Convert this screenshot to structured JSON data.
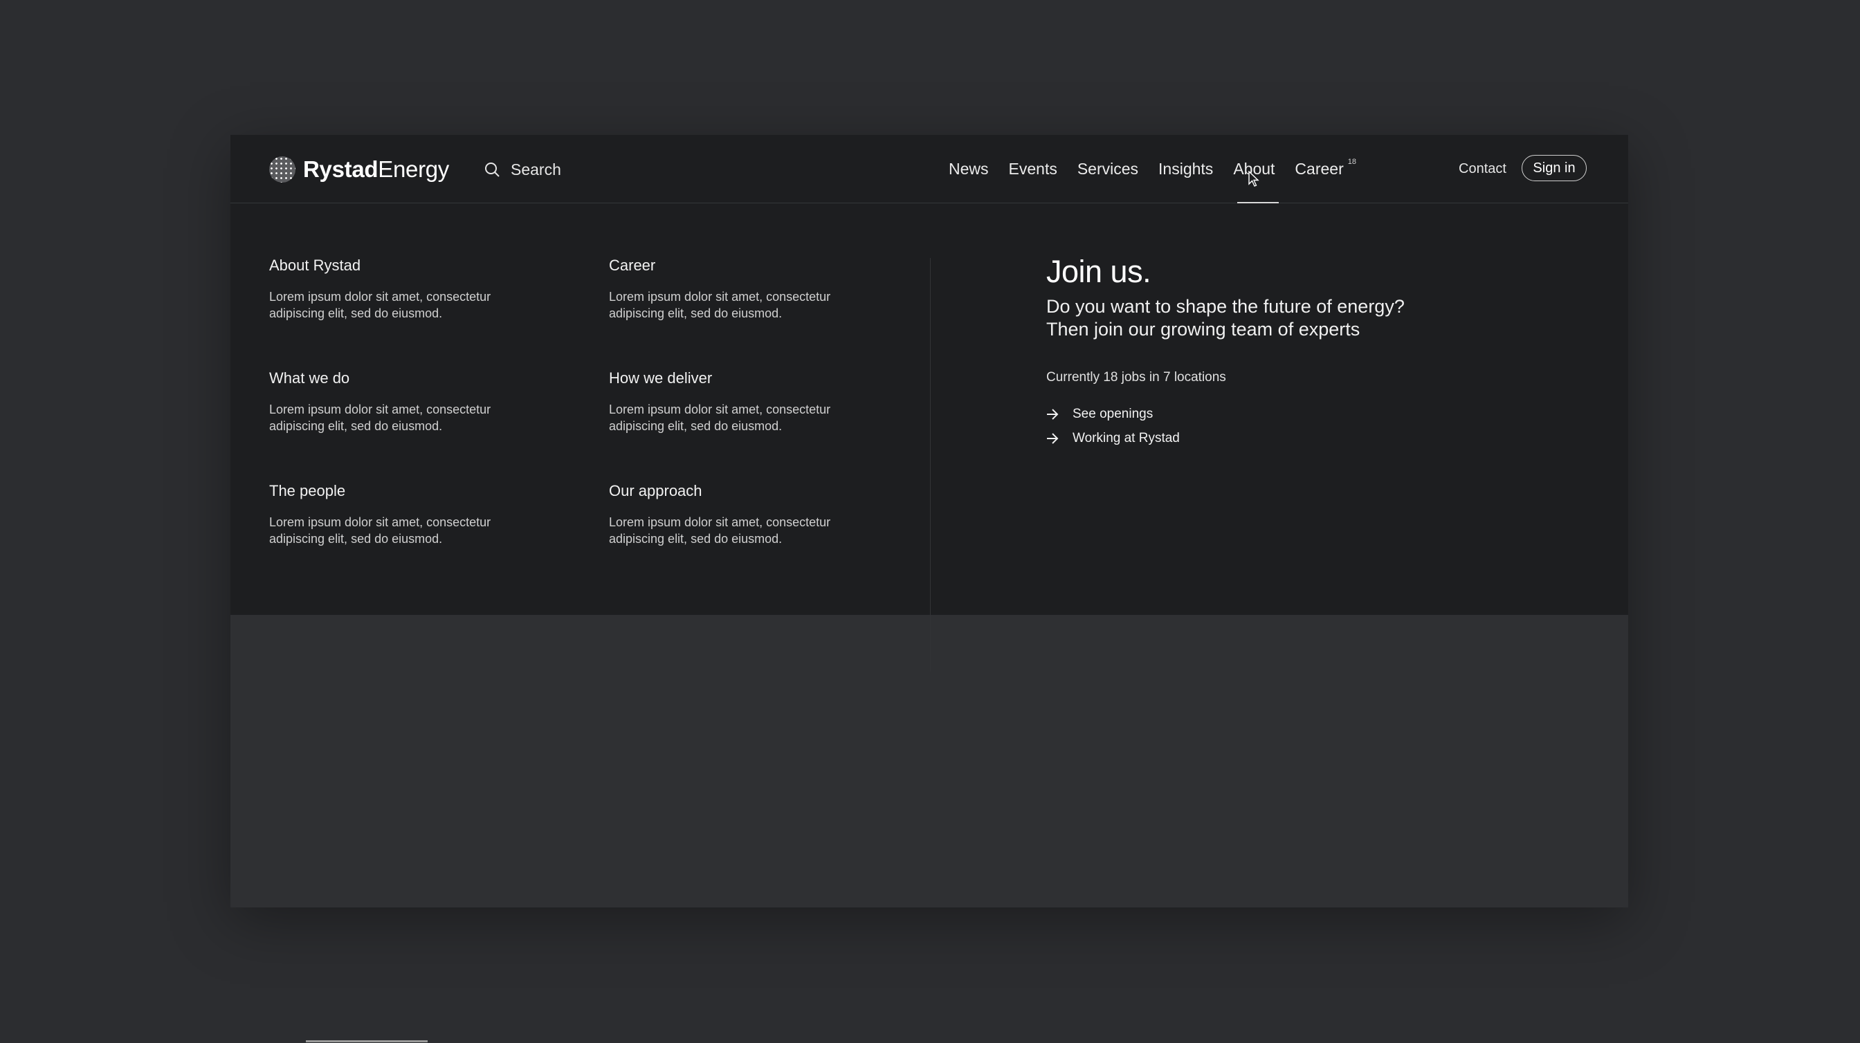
{
  "header": {
    "logo": {
      "bold": "Rystad",
      "light": "Energy"
    },
    "search_label": "Search",
    "nav": [
      {
        "label": "News"
      },
      {
        "label": "Events"
      },
      {
        "label": "Services"
      },
      {
        "label": "Insights"
      },
      {
        "label": "About",
        "active": true
      },
      {
        "label": "Career",
        "badge": "18"
      }
    ],
    "contact_label": "Contact",
    "signin_label": "Sign in"
  },
  "menu": {
    "items": [
      {
        "title": "About Rystad",
        "desc": "Lorem ipsum dolor sit amet, consectetur adipiscing elit, sed do eiusmod."
      },
      {
        "title": "Career",
        "desc": "Lorem ipsum dolor sit amet, consectetur adipiscing elit, sed do eiusmod."
      },
      {
        "title": "What we do",
        "desc": "Lorem ipsum dolor sit amet, consectetur adipiscing elit, sed do eiusmod."
      },
      {
        "title": "How we deliver",
        "desc": "Lorem ipsum dolor sit amet, consectetur adipiscing elit, sed do eiusmod."
      },
      {
        "title": "The people",
        "desc": "Lorem ipsum dolor sit amet, consectetur adipiscing elit, sed do eiusmod."
      },
      {
        "title": "Our approach",
        "desc": "Lorem ipsum dolor sit amet, consectetur adipiscing elit, sed do eiusmod."
      }
    ]
  },
  "join": {
    "title": "Join us.",
    "subtitle_line1": "Do you want to shape the future of energy?",
    "subtitle_line2": "Then join our growing team of experts",
    "count_text": "Currently 18 jobs in 7 locations",
    "links": [
      {
        "label": "See openings",
        "icon": "arrow-right-icon"
      },
      {
        "label": "Working at Rystad",
        "icon": "arrow-right-icon"
      }
    ]
  },
  "colors": {
    "page_bg": "#2c2d30",
    "panel_bg": "#1d1e20",
    "text": "#ffffff"
  }
}
